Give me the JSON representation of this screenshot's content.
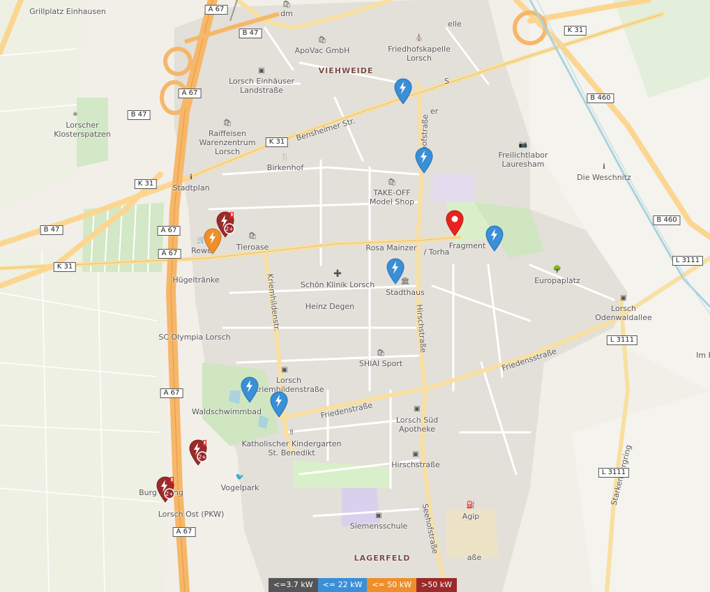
{
  "labels": {
    "grillplatz": "Grillplatz Einhausen",
    "dm": "dm",
    "apovac": "ApoVac GmbH",
    "friedhofskapelle": "Friedhofskapelle\nLorsch",
    "elle": "elle",
    "viehweide": "VIEHWEIDE",
    "lorsch_einhaeuser": "Lorsch Einhäuser\nLandstraße",
    "klosterspatzen": "Lorscher\nKlosterspatzen",
    "raiffeisen": "Raiffeisen\nWarenzentrum\nLorsch",
    "birkenhof": "Birkenhof",
    "freilichtlabor": "Freilichtlabor\nLauresham",
    "die_weschnitz": "Die Weschnitz",
    "stadtplan": "Stadtplan",
    "takeoff": "TAKE-OFF\nModel Shop",
    "tieroase": "Tieroase",
    "rewe": "Rewe",
    "rosa_mainzer": "Rosa Mainzer",
    "torhalle": "/ Torha",
    "fragment": "Fragment",
    "schoen_klinik": "Schön Klinik Lorsch",
    "huegeltraenke": "Hügeltränke",
    "stadthaus": "Stadthaus",
    "europaplatz": "Europaplatz",
    "heinz_degen": "Heinz Degen",
    "lorsch_odenwaldallee": "Lorsch\nOdenwaldallee",
    "sc_olympia": "SC Olympia Lorsch",
    "shiai": "SHIAI Sport",
    "im": "Im F",
    "lorsch_kriemhilden": "Lorsch\nKriemhildenstraße",
    "waldschwimmbad": "Waldschwimmbad",
    "lorsch_sued": "Lorsch Süd\nApotheke",
    "kindergarten": "Katholischer Kindergarten\nSt. Benedikt",
    "hirschstrasse_stop": "Hirschstraße",
    "vogelpark": "Vogelpark",
    "burg": "Burg",
    "burg_end": "ng",
    "lorsch_ost": "Lorsch Ost (PKW)",
    "agip": "Agip",
    "siemensschule": "Siemensschule",
    "lagerfeld": "LAGERFELD",
    "asse": "aße"
  },
  "streets": {
    "bensheimer": "Bensheimer Str.",
    "nibelungen": "hofstraße",
    "kriemhildenstr": "Kriemhildenstr.",
    "hirschstrasse": "Hirschstraße",
    "friedensstrasse_w": "Friedenstraße",
    "friedensstrasse_e": "Friedensstraße",
    "seehofstrasse": "Seehofstraße",
    "starkenburgring": "Starkenburgring",
    "street_s": "S",
    "street_er": "er"
  },
  "shields": {
    "a67_1": "A 67",
    "b47_1": "B 47",
    "a67_2": "A 67",
    "b47_2": "B 47",
    "k31_1": "K 31",
    "k31_2": "K 31",
    "b460_1": "B 460",
    "b47_3": "B 47",
    "a67_3": "A 67",
    "a67_4": "A 67",
    "k31_3": "K 31",
    "k31_4": "K 31",
    "b460_2": "B 460",
    "l3111_1": "L 3111",
    "l3111_2": "L 3111",
    "l3111_3": "L 3111",
    "a67_5": "A 67",
    "a67_6": "A 67"
  },
  "markers": [
    {
      "type": "charger-22kw",
      "color": "#3a8fd6"
    },
    {
      "type": "charger-22kw",
      "color": "#3a8fd6"
    },
    {
      "type": "charger-22kw",
      "color": "#3a8fd6"
    },
    {
      "type": "charger-22kw",
      "color": "#3a8fd6"
    },
    {
      "type": "charger-22kw",
      "color": "#3a8fd6"
    },
    {
      "type": "charger-22kw",
      "color": "#3a8fd6"
    },
    {
      "type": "charger-50kw",
      "color": "#ef8f2b"
    },
    {
      "type": "charger-over-50kw-cluster",
      "color": "#9b2a2a",
      "badge": "2+"
    },
    {
      "type": "charger-over-50kw-cluster",
      "color": "#9b2a2a",
      "badge": "2+"
    },
    {
      "type": "charger-over-50kw-cluster",
      "color": "#9b2a2a",
      "badge": "2+"
    },
    {
      "type": "selected-location",
      "color": "#e8231f"
    }
  ],
  "legend": {
    "items": [
      {
        "label": "<=3.7 kW",
        "color": "#555555"
      },
      {
        "label": "<= 22 kW",
        "color": "#3a8fd6"
      },
      {
        "label": "<= 50 kW",
        "color": "#ef8f2b"
      },
      {
        "label": ">50 kW",
        "color": "#9b2a2a"
      }
    ]
  }
}
